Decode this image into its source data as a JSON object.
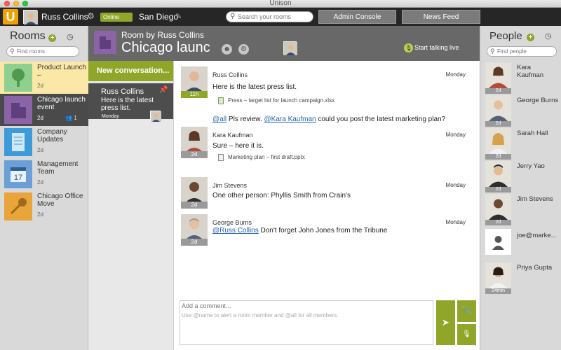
{
  "window": {
    "title": "Unison"
  },
  "topbar": {
    "logo": "U",
    "user_name": "Russ Collins",
    "status": "Online",
    "location": "San Diego",
    "search_placeholder": "Search your rooms",
    "admin_label": "Admin Console",
    "news_label": "News Feed"
  },
  "rooms": {
    "header": "Rooms",
    "find_placeholder": "Find rooms",
    "items": [
      {
        "name": "Product Launch –",
        "time": "2d",
        "icon": "tree-icon",
        "color": "#8fcf8f"
      },
      {
        "name": "Chicago launch event",
        "time": "2d",
        "members": "1",
        "icon": "building-icon",
        "color": "#8b63a7"
      },
      {
        "name": "Company Updates",
        "time": "2d",
        "icon": "document-icon",
        "color": "#3d9bd9"
      },
      {
        "name": "Management Team",
        "time": "2d",
        "icon": "calendar-icon",
        "color": "#6a9fd8"
      },
      {
        "name": "Chicago Office Move",
        "time": "2d",
        "icon": "key-icon",
        "color": "#e9a53a"
      }
    ]
  },
  "conversations": {
    "new_label": "New conversation...",
    "items": [
      {
        "author": "Russ Collins",
        "preview": "Here is the latest press list.",
        "day": "Monday"
      }
    ]
  },
  "room_header": {
    "subtitle": "Room by Russ Collins",
    "title": "Chicago launch event",
    "talk_label": "Start talking live"
  },
  "messages": [
    {
      "author": "Russ Collins",
      "day": "Monday",
      "age": "11h",
      "text": "Here is the latest press list.",
      "attachment": "Press – target list for launch campaign.xlsx",
      "followup": {
        "mention1": "@all",
        "mid": " Pls review. ",
        "mention2": "@Kara Kaufman",
        "rest": " could you post the latest marketing plan?"
      }
    },
    {
      "author": "Kara Kaufman",
      "day": "Monday",
      "age": "2d",
      "text": "Sure – here it is.",
      "attachment": "Marketing plan – first draft.pptx"
    },
    {
      "author": "Jim Stevens",
      "day": "Monday",
      "age": "2d",
      "text": "One other person: Phyllis Smith from Crain's"
    },
    {
      "author": "George Burns",
      "day": "Monday",
      "age": "2d",
      "mention": "@Russ Collins",
      "text": " Don't forget John Jones from the Tribune"
    }
  ],
  "composer": {
    "placeholder": "Add a comment...",
    "hint": "Use @name to alert a room member and @all for all members."
  },
  "people": {
    "header": "People",
    "find_placeholder": "Find people",
    "items": [
      {
        "name": "Kara Kaufman",
        "age": "2d"
      },
      {
        "name": "George Burns",
        "age": "2d"
      },
      {
        "name": "Sarah Hall",
        "age": "2d"
      },
      {
        "name": "Jerry Yao",
        "age": "2d"
      },
      {
        "name": "Jim Stevens",
        "age": "2d"
      },
      {
        "name": "joe@marke...",
        "age": ""
      },
      {
        "name": "Priya Gupta",
        "age": "24min"
      }
    ]
  },
  "colors": {
    "accent": "#8fa629",
    "dark": "#262626",
    "selected": "#4a4a4a",
    "active": "#fbe8a6"
  }
}
